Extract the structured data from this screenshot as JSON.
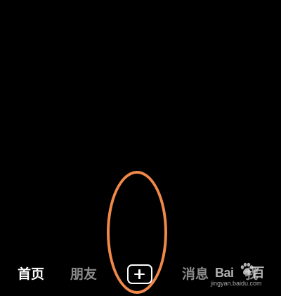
{
  "tabbar": {
    "tabs": [
      {
        "label": "首页",
        "active": true
      },
      {
        "label": "朋友",
        "active": false
      },
      {
        "label": "消息",
        "active": false
      },
      {
        "label": "我",
        "active": false
      }
    ],
    "create_icon": "plus-icon"
  },
  "annotation": {
    "shape": "oval",
    "color": "#f0884a"
  },
  "watermark": {
    "logo_left": "Bai",
    "logo_right": "百",
    "url": "jingyan.baidu.com"
  },
  "colors": {
    "background": "#000000",
    "active_tab": "#ffffff",
    "inactive_tab": "#8a8a8a"
  }
}
